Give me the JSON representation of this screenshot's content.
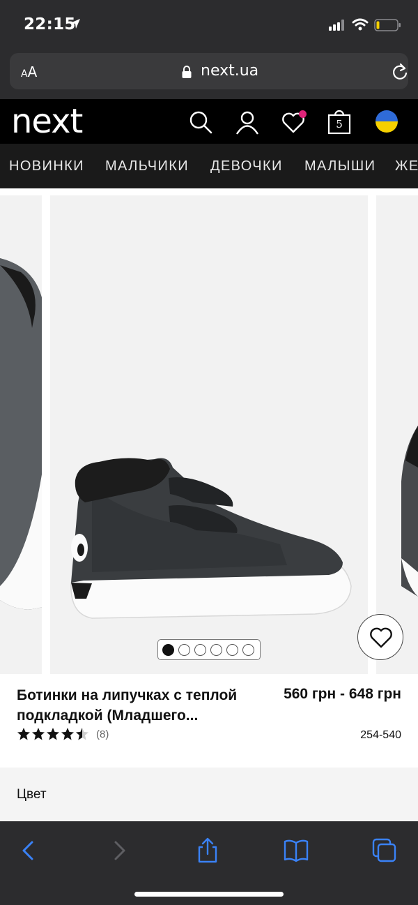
{
  "status_bar": {
    "time": "22:15"
  },
  "address_bar": {
    "text_size_label_small": "A",
    "text_size_label_large": "A",
    "url": "next.ua"
  },
  "header": {
    "logo": "next",
    "bag_count": "5"
  },
  "nav": {
    "items": [
      "НОВИНКИ",
      "МАЛЬЧИКИ",
      "ДЕВОЧКИ",
      "МАЛЫШИ",
      "ЖЕ"
    ]
  },
  "gallery": {
    "dot_count": 6,
    "active_index": 0
  },
  "product": {
    "name": "Ботинки на липучках с теплой подкладкой  (Младшего...",
    "price": "560 грн - 648 грн",
    "rating": 4.5,
    "review_count": "(8)",
    "sku": "254-540"
  },
  "color_section": {
    "label": "Цвет"
  },
  "colors": {
    "accent": "#3a82f7",
    "badge": "#e0247a",
    "flag_blue": "#2f6bd8",
    "flag_yellow": "#f5d000"
  }
}
